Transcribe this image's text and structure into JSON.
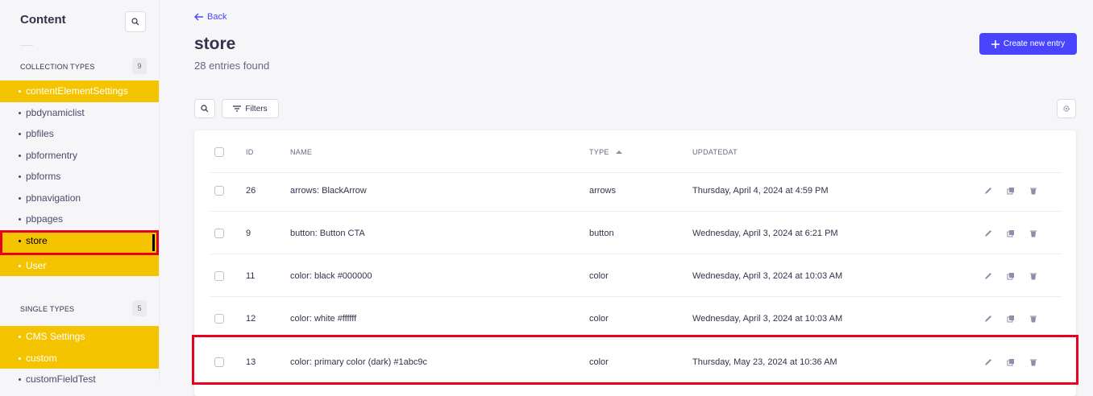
{
  "sidebar": {
    "title": "Content",
    "collection_label": "COLLECTION TYPES",
    "collection_count": "9",
    "collection_items": [
      {
        "label": "contentElementSettings"
      },
      {
        "label": "pbdynamiclist"
      },
      {
        "label": "pbfiles"
      },
      {
        "label": "pbformentry"
      },
      {
        "label": "pbforms"
      },
      {
        "label": "pbnavigation"
      },
      {
        "label": "pbpages"
      },
      {
        "label": "store"
      },
      {
        "label": "User"
      }
    ],
    "single_label": "SINGLE TYPES",
    "single_count": "5",
    "single_items": [
      {
        "label": "CMS Settings"
      },
      {
        "label": "custom"
      },
      {
        "label": "customFieldTest"
      }
    ]
  },
  "header": {
    "back_label": "Back",
    "title": "store",
    "subtitle": "28 entries found",
    "create_label": "Create new entry"
  },
  "toolbar": {
    "filters_label": "Filters"
  },
  "table": {
    "headers": {
      "id": "ID",
      "name": "NAME",
      "type": "TYPE",
      "updated": "UPDATEDAT"
    },
    "rows": [
      {
        "id": "26",
        "name": "arrows: BlackArrow",
        "type": "arrows",
        "updated": "Thursday, April 4, 2024 at 4:59 PM"
      },
      {
        "id": "9",
        "name": "button: Button CTA",
        "type": "button",
        "updated": "Wednesday, April 3, 2024 at 6:21 PM"
      },
      {
        "id": "11",
        "name": "color: black #000000",
        "type": "color",
        "updated": "Wednesday, April 3, 2024 at 10:03 AM"
      },
      {
        "id": "12",
        "name": "color: white #ffffff",
        "type": "color",
        "updated": "Wednesday, April 3, 2024 at 10:03 AM"
      },
      {
        "id": "13",
        "name": "color: primary color (dark) #1abc9c",
        "type": "color",
        "updated": "Thursday, May 23, 2024 at 10:36 AM"
      }
    ]
  },
  "colors": {
    "accent": "#4945ff",
    "highlight": "#f5c400",
    "annotation": "#e8001f"
  }
}
